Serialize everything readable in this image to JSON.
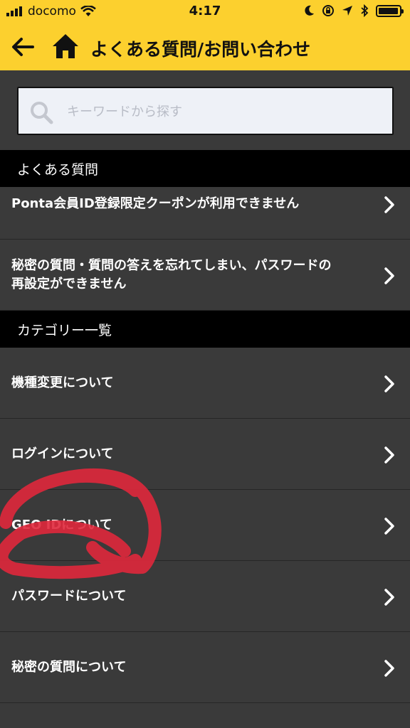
{
  "status_bar": {
    "carrier": "docomo",
    "time": "4:17"
  },
  "header": {
    "title": "よくある質問/お問い合わせ",
    "background_color": "#fcd02e"
  },
  "search": {
    "placeholder": "キーワードから探す",
    "value": ""
  },
  "faq_section": {
    "title": "よくある質問",
    "items": [
      {
        "label": "Ponta会員ID登録限定クーポンが利用できません"
      },
      {
        "label_line1": "秘密の質問・質問の答えを忘れてしまい、パスワードの",
        "label_line2": "再設定ができません"
      }
    ]
  },
  "category_section": {
    "title": "カテゴリー一覧",
    "items": [
      {
        "label": "機種変更について"
      },
      {
        "label": "ログインについて"
      },
      {
        "label": "GEO IDについて"
      },
      {
        "label": "パスワードについて"
      },
      {
        "label": "秘密の質問について"
      }
    ]
  },
  "annotation_color": "#e0283c"
}
